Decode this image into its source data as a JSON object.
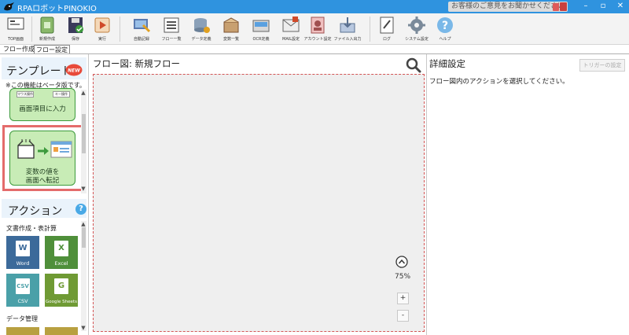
{
  "app": {
    "title": "RPAロボットPINOKIO",
    "feedback": "お客様のご意見をお聞かせください",
    "window_controls": [
      "–",
      "▫",
      "✕"
    ]
  },
  "toolbar": {
    "items": [
      {
        "label": "TOP画面",
        "icon": "top-screen-icon"
      },
      {
        "label": "新規作成",
        "icon": "new-file-icon"
      },
      {
        "label": "保存",
        "icon": "save-icon"
      },
      {
        "label": "実行",
        "icon": "run-icon"
      },
      {
        "label": "自動記録",
        "icon": "record-icon"
      },
      {
        "label": "フロー一覧",
        "icon": "flow-list-icon"
      },
      {
        "label": "データ定義",
        "icon": "data-definition-icon"
      },
      {
        "label": "変数一覧",
        "icon": "variable-list-icon"
      },
      {
        "label": "OCR定義",
        "icon": "ocr-icon"
      },
      {
        "label": "MAIL設定",
        "icon": "mail-icon"
      },
      {
        "label": "アカウント設定",
        "icon": "account-icon"
      },
      {
        "label": "ファイル入出力",
        "icon": "file-io-icon"
      },
      {
        "label": "ログ",
        "icon": "log-icon"
      },
      {
        "label": "システム設定",
        "icon": "gear-icon"
      },
      {
        "label": "ヘルプ",
        "icon": "help-icon"
      }
    ]
  },
  "tabs": [
    {
      "label": "フロー作成",
      "active": true
    },
    {
      "label": "フロー設定",
      "active": false
    }
  ],
  "templates": {
    "title": "テンプレート",
    "badge": "NEW",
    "note": "※この機能はベータ版です。",
    "cards": [
      {
        "label": "画面項目に入力",
        "mini_labels": [
          "マウス操作",
          "キー操作"
        ]
      },
      {
        "label": "変数の値を\n画面へ転記",
        "line1": "変数の値を",
        "line2": "画面へ転記"
      }
    ]
  },
  "actions": {
    "title": "アクション",
    "help": "?",
    "categories": [
      {
        "label": "文書作成・表計算",
        "items": [
          {
            "label": "Word",
            "letter": "W",
            "color": "#3c6a9a"
          },
          {
            "label": "Excel",
            "letter": "X",
            "color": "#4f8f3a"
          },
          {
            "label": "CSV",
            "letter": "CSV",
            "color": "#4aa0a8"
          },
          {
            "label": "Google Sheets",
            "letter": "G",
            "color": "#6f9a34"
          }
        ]
      },
      {
        "label": "データ管理",
        "items": []
      }
    ]
  },
  "flow": {
    "header": "フロー図:  新規フロー",
    "zoom": "75%"
  },
  "details": {
    "title": "詳細設定",
    "trigger_button": "トリガーの設定",
    "message": "フロー図内のアクションを選択してください。"
  },
  "colors": {
    "titlebar": "#2f93df",
    "canvas_border": "#d45555",
    "highlight": "#e46b6b",
    "template_card": "#c8ecb6"
  }
}
